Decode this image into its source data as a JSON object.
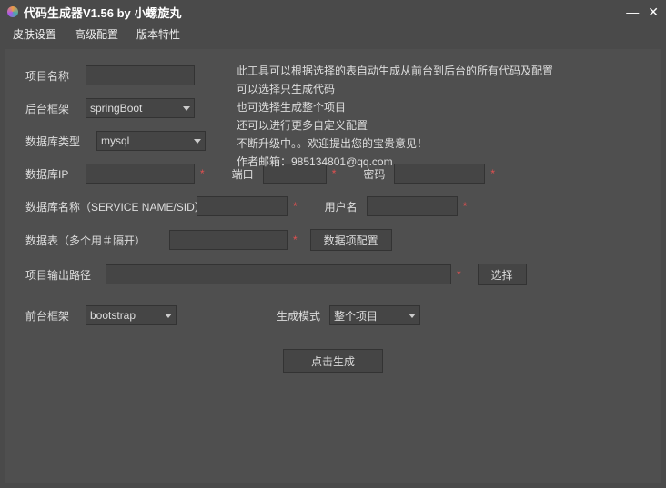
{
  "title": "代码生成器V1.56 by 小螺旋丸",
  "menu": {
    "skin": "皮肤设置",
    "adv": "高级配置",
    "ver": "版本特性"
  },
  "desc": {
    "l1": "此工具可以根据选择的表自动生成从前台到后台的所有代码及配置",
    "l2": "可以选择只生成代码",
    "l3": "也可选择生成整个项目",
    "l4": "还可以进行更多自定义配置",
    "l5": "不断升级中。。欢迎提出您的宝贵意见！",
    "l6": "作者邮箱：985134801@qq.com"
  },
  "labels": {
    "projName": "项目名称",
    "backend": "后台框架",
    "dbType": "数据库类型",
    "dbIp": "数据库IP",
    "port": "端口",
    "pwd": "密码",
    "dbName": "数据库名称（SERVICE NAME/SID）",
    "user": "用户名",
    "tables": "数据表（多个用＃隔开）",
    "dataCfg": "数据项配置",
    "output": "项目输出路径",
    "choose": "选择",
    "frontend": "前台框架",
    "mode": "生成模式",
    "gen": "点击生成"
  },
  "values": {
    "projName": "",
    "backend": "springBoot",
    "dbType": "mysql",
    "dbIp": "",
    "port": "",
    "pwd": "",
    "dbName": "",
    "user": "",
    "tables": "",
    "output": "",
    "frontend": "bootstrap",
    "mode": "整个项目"
  }
}
